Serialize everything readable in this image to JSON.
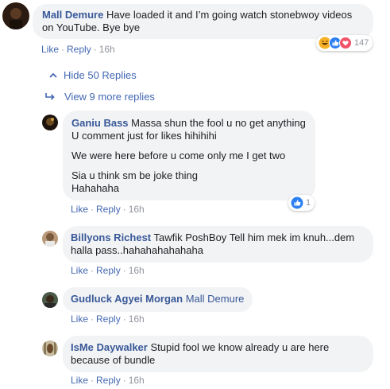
{
  "comments": {
    "c1": {
      "author": "Mall Demure",
      "text": "Have loaded it and I’m going watch stonebwoy videos on YouTube. Bye bye",
      "reaction_count": "147",
      "reaction_icons": [
        "haha-icon",
        "like-icon",
        "love-icon"
      ]
    },
    "c2": {
      "author": "Ganiu Bass",
      "line1": "Massa shun the fool u no get anything",
      "line2": "U comment just for likes hihihihi",
      "para2": "We were here before u come only me I get two",
      "para3_line1": "Sia u think sm be joke thing",
      "para3_line2": "Hahahaha",
      "reaction_count": "1",
      "reaction_icons": [
        "like-icon"
      ]
    },
    "c3": {
      "author": "Billyons Richest",
      "tag": "Tawfik PoshBoy",
      "text_line1": "Tell him mek im knuh...dem",
      "text_line2": "halla pass..hahahahahahaha"
    },
    "c4": {
      "author": "Gudluck Agyei Morgan",
      "tag": "Mall Demure"
    },
    "c5": {
      "author": "IsMe Daywalker",
      "text_line1": "Stupid fool we know already u are here",
      "text_line2": "because of bundle"
    }
  },
  "actions": {
    "like": "Like",
    "reply": "Reply",
    "separator": "·",
    "time": "16h"
  },
  "replies": {
    "hide": "Hide 50 Replies",
    "more": "View 9 more replies"
  },
  "colors": {
    "link": "#385898",
    "action": "#4267b2",
    "bubble": "#f2f3f5",
    "like": "#2e81f4",
    "love": "#f25268",
    "haha": "#f7b125"
  }
}
